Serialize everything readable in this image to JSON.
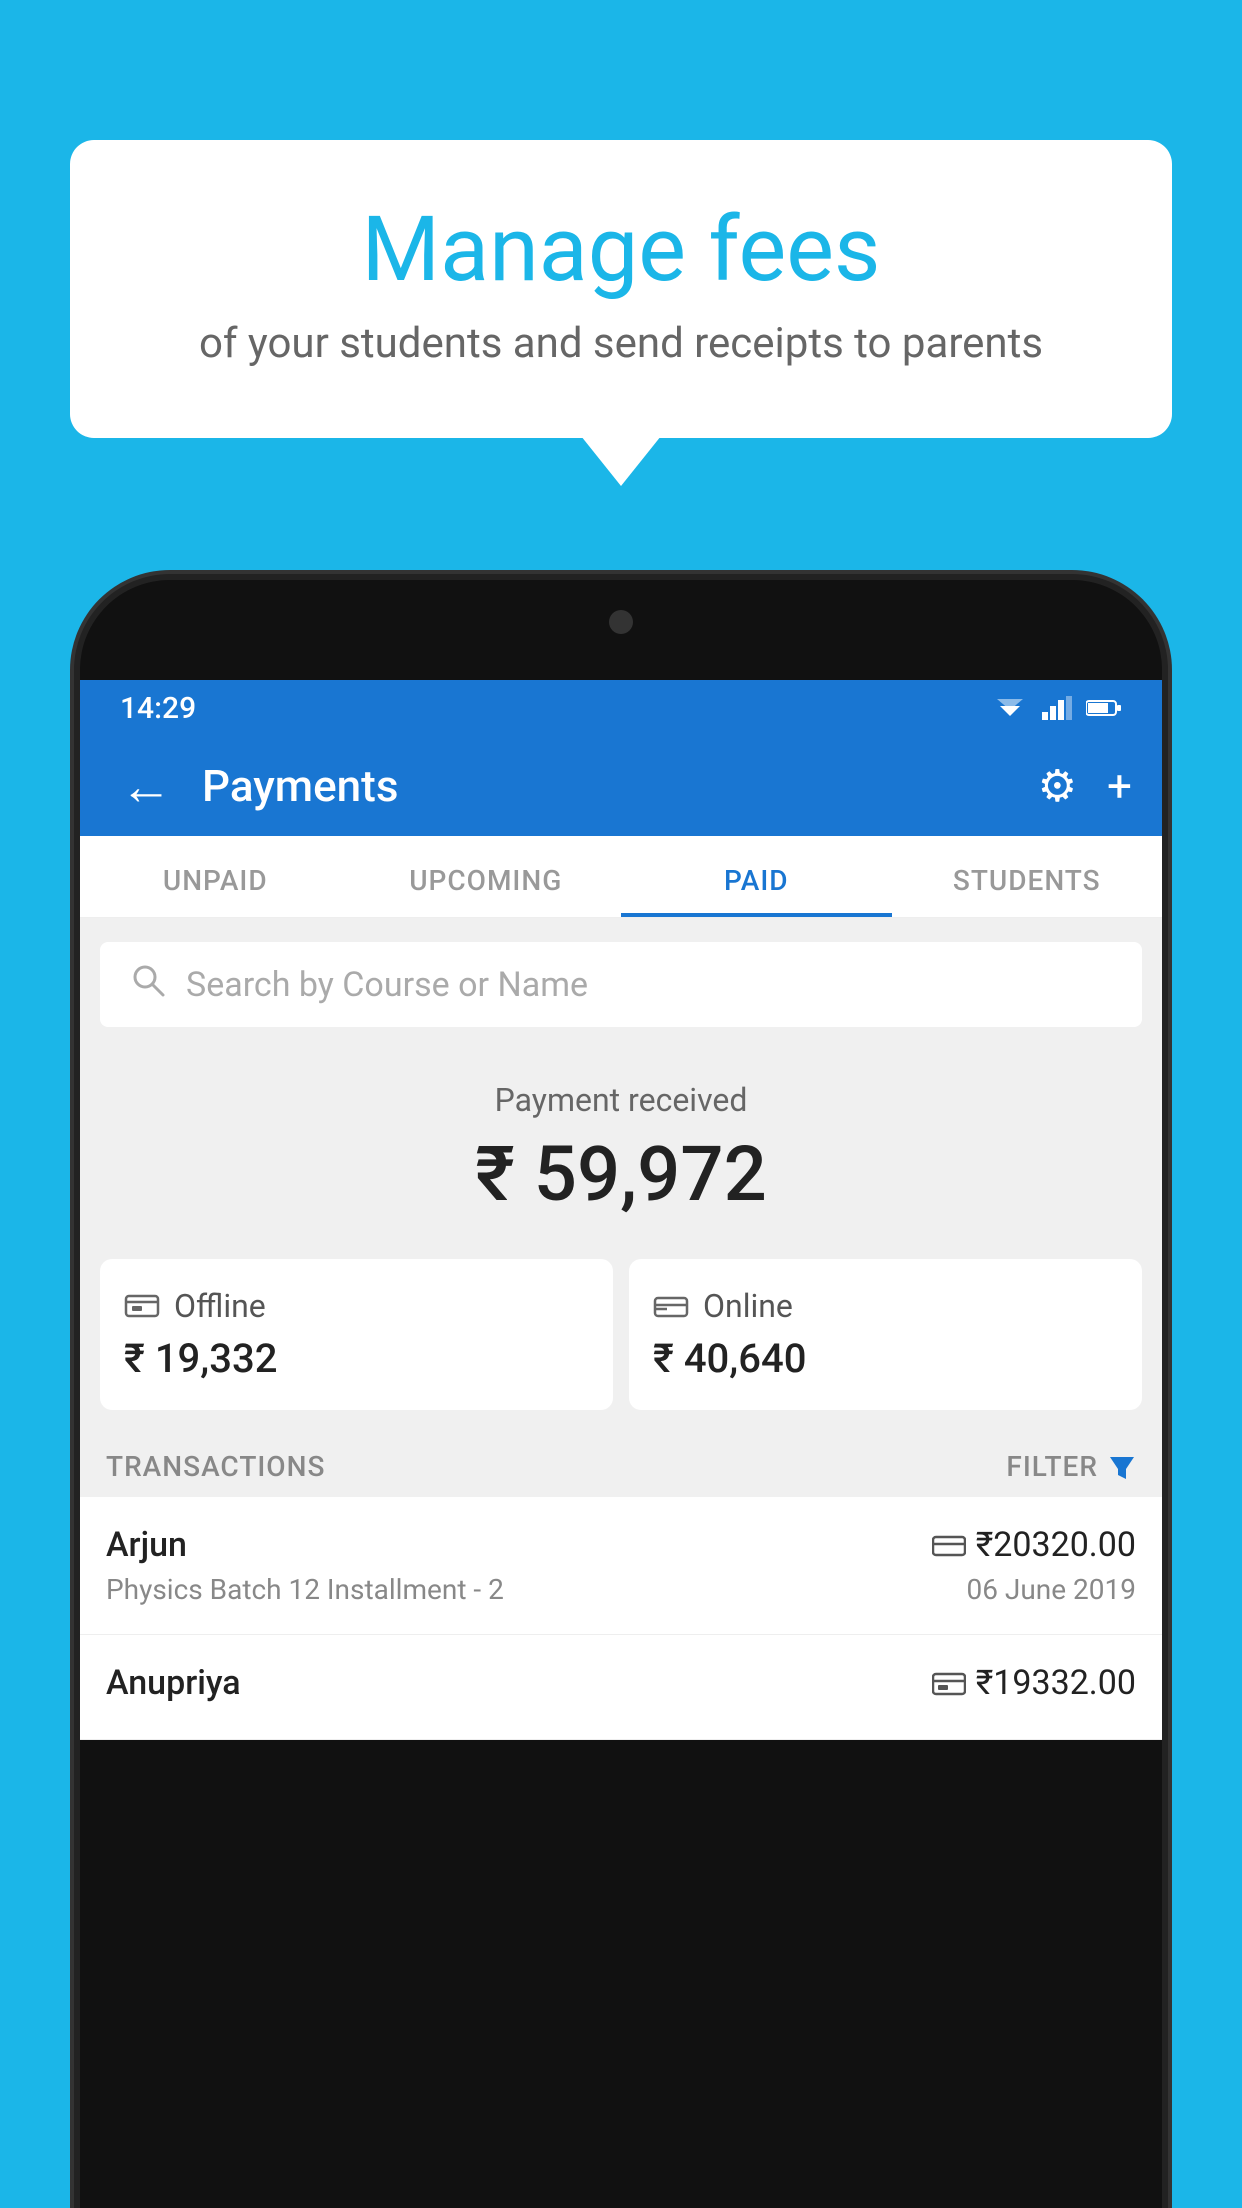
{
  "background_color": "#1BB6E8",
  "bubble": {
    "title": "Manage fees",
    "subtitle": "of your students and send receipts to parents"
  },
  "status_bar": {
    "time": "14:29",
    "wifi": "▼",
    "signal": "▲",
    "battery": "▮"
  },
  "app_bar": {
    "title": "Payments",
    "back_icon": "←",
    "settings_icon": "⚙",
    "add_icon": "+"
  },
  "tabs": [
    {
      "label": "UNPAID",
      "active": false
    },
    {
      "label": "UPCOMING",
      "active": false
    },
    {
      "label": "PAID",
      "active": true
    },
    {
      "label": "STUDENTS",
      "active": false
    }
  ],
  "search": {
    "placeholder": "Search by Course or Name"
  },
  "payment_summary": {
    "label": "Payment received",
    "amount": "₹ 59,972"
  },
  "payment_cards": [
    {
      "icon": "offline",
      "label": "Offline",
      "amount": "₹ 19,332"
    },
    {
      "icon": "online",
      "label": "Online",
      "amount": "₹ 40,640"
    }
  ],
  "transactions_header": {
    "label": "TRANSACTIONS",
    "filter_label": "FILTER",
    "filter_icon": "▼"
  },
  "transactions": [
    {
      "name": "Arjun",
      "description": "Physics Batch 12 Installment - 2",
      "amount": "₹20320.00",
      "date": "06 June 2019",
      "pay_type": "online"
    },
    {
      "name": "Anupriya",
      "description": "",
      "amount": "₹19332.00",
      "date": "",
      "pay_type": "offline"
    }
  ]
}
